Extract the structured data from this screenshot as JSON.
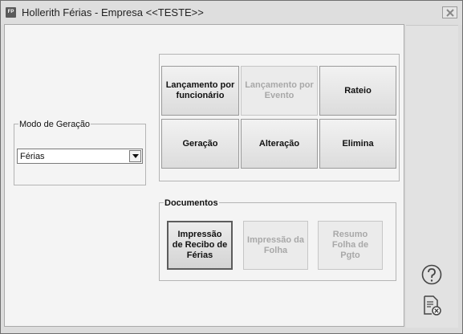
{
  "window": {
    "title": "Hollerith Férias - Empresa <<TESTE>>",
    "app_icon_text": "FP"
  },
  "modo_geracao": {
    "label": "Modo de Geração",
    "selected": "Férias"
  },
  "actions": {
    "lancamento_funcionario": "Lançamento por funcionário",
    "lancamento_evento": "Lançamento por Evento",
    "rateio": "Rateio",
    "geracao": "Geração",
    "alteracao": "Alteração",
    "elimina": "Elimina"
  },
  "documentos": {
    "label": "Documentos",
    "impressao_recibo": "Impressão de Recibo de Férias",
    "impressao_folha": "Impressão da Folha",
    "resumo_folha": "Resumo Folha de Pgto"
  },
  "side_icons": [
    "help-icon",
    "close-document-icon"
  ],
  "colors": {
    "window_bg": "#dcdcdc",
    "client_bg": "#f4f4f4",
    "disabled_text": "#a8a8a8"
  }
}
